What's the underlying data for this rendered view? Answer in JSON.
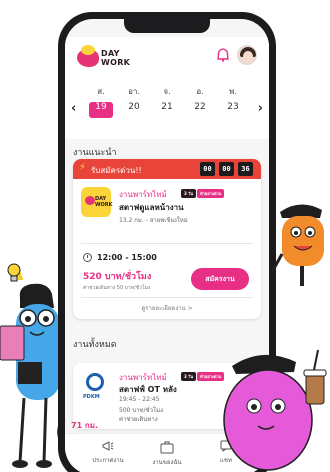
{
  "app": {
    "logo_line1": "DAY",
    "logo_line2": "WORK"
  },
  "calendar": {
    "days": [
      {
        "dow": "ส.",
        "date": "19",
        "active": true
      },
      {
        "dow": "อา.",
        "date": "20",
        "active": false
      },
      {
        "dow": "จ.",
        "date": "21",
        "active": false
      },
      {
        "dow": "อ.",
        "date": "22",
        "active": false
      },
      {
        "dow": "พ.",
        "date": "23",
        "active": false
      }
    ]
  },
  "recommended": {
    "section_title": "งานแนะนำ",
    "urgent_label": "รับสมัครด่วน!!",
    "timer": [
      "00",
      "00",
      "36"
    ],
    "job_type": "งานพาร์ทไทม์",
    "badge1": "3 วัน",
    "badge2": "ทำอย่างด่วน",
    "job_title": "สตาฟดูแลหน้างาน",
    "job_meta": "13.2 กม. - สายพเชียงใหม่",
    "time_range": "12:00 - 15:00",
    "wage": "520 บาท/ชั่วโมง",
    "travel": "ค่าช่วยเดินทาง 50 บาท/ชั่วโมง",
    "apply_label": "สมัครงาน",
    "details_label": "ดูรายละเอียดงาน >"
  },
  "all_jobs": {
    "section_title": "งานทั้งหมด",
    "job_type": "งานพาร์ทไทม์",
    "badge1": "3 วัน",
    "badge2": "ทำอย่างด่วน",
    "job_title": "สตาฟฟ์ OT หลัง",
    "time": "19:45 - 22:45",
    "wage_line": "500 บาท/ชั่วโมง",
    "travel": "ค่าช่วยเดินทาง",
    "partial_wage": "71 กม.",
    "logo_text": "PDKM"
  },
  "nav": {
    "items": [
      {
        "label": "ประกาศงาน",
        "icon": "megaphone-icon"
      },
      {
        "label": "งานของฉัน",
        "icon": "briefcase-icon"
      },
      {
        "label": "แชท",
        "icon": "chat-icon"
      }
    ]
  },
  "colors": {
    "accent": "#e82f86",
    "urgent": "#e8443a",
    "brand_yellow": "#fbd43a"
  }
}
